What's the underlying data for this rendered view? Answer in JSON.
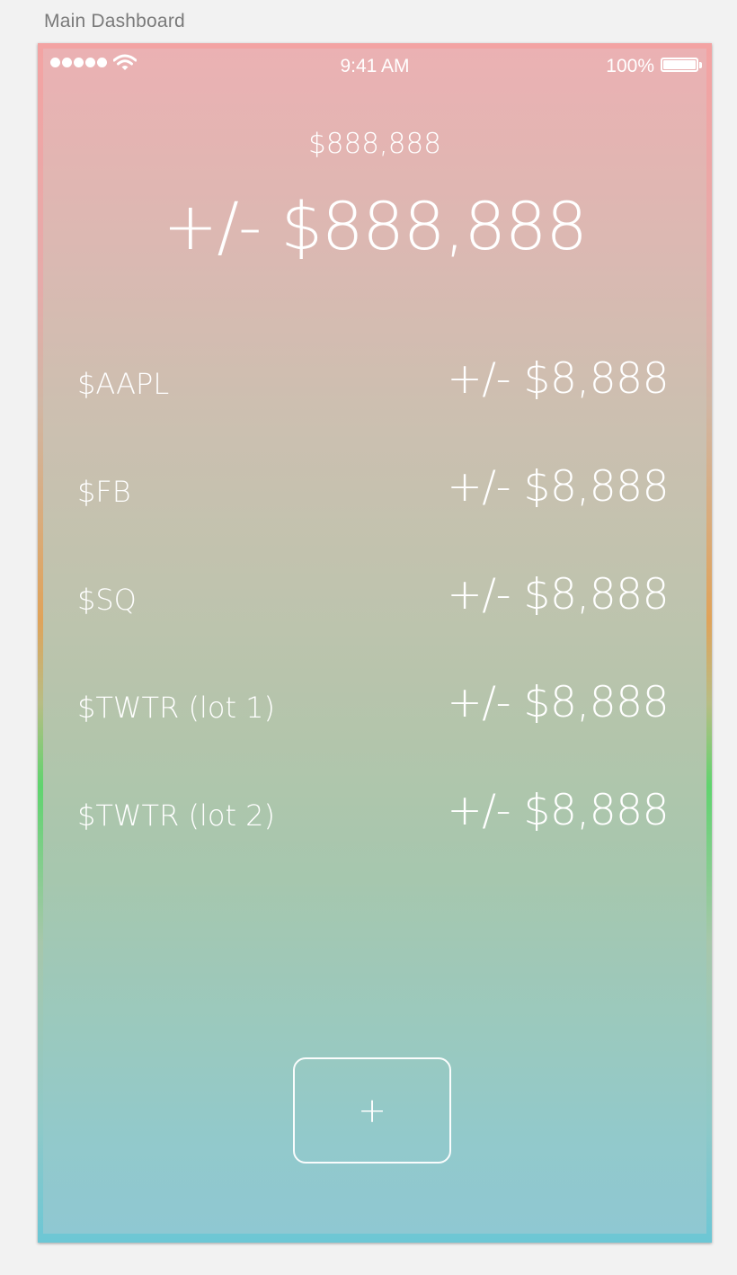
{
  "artboard": {
    "title": "Main Dashboard"
  },
  "status_bar": {
    "signal_bars": 5,
    "wifi_icon": "wifi-icon",
    "time": "9:41 AM",
    "battery_percent": "100%",
    "battery_level": 1.0
  },
  "portfolio": {
    "total_value": "$888,888",
    "total_change": "+/- $888,888"
  },
  "holdings": [
    {
      "symbol": "$AAPL",
      "change": "+/- $8,888"
    },
    {
      "symbol": "$FB",
      "change": "+/- $8,888"
    },
    {
      "symbol": "$SQ",
      "change": "+/- $8,888"
    },
    {
      "symbol": "$TWTR (lot 1)",
      "change": "+/- $8,888"
    },
    {
      "symbol": "$TWTR (lot 2)",
      "change": "+/- $8,888"
    }
  ],
  "actions": {
    "add_label": "+"
  },
  "colors": {
    "gradient_top": "#ebb1b3",
    "gradient_middle": "#b3c5ab",
    "gradient_bottom": "#8fc8d2",
    "text": "#ffffff"
  }
}
